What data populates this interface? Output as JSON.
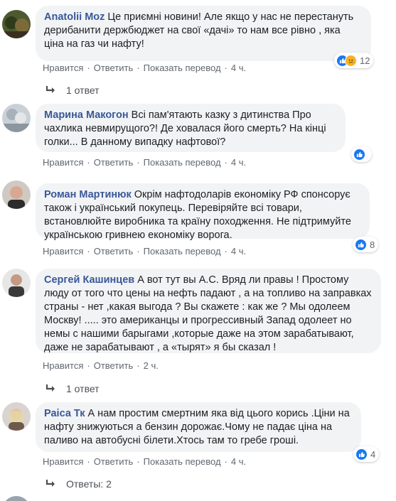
{
  "comments": [
    {
      "author": "Anatolii Moz",
      "text": "Це приємні новини! Але якщо у нас не перестануть дерибанити держбюджет на свої «дачі» то нам все рівно , яка ціна на газ чи нафту!",
      "reactions": {
        "icons": [
          "like-icon",
          "sad-icon"
        ],
        "count": "12"
      },
      "like": "Нравится",
      "reply": "Ответить",
      "translate": "Показать перевод",
      "time": "4 ч.",
      "replies": "1 ответ"
    },
    {
      "author": "Марина Макогон",
      "text": "Всі пам'ятають казку з дитинства Про чахлика невмирущого?! Де ховалася його смерть? На кінці голки... В данному випадку нафтової?",
      "reactions": {
        "icons": [
          "like-icon"
        ],
        "count": ""
      },
      "like": "Нравится",
      "reply": "Ответить",
      "translate": "Показать перевод",
      "time": "4 ч."
    },
    {
      "author": "Роман Мартинюк",
      "text": "Окрім нафтодоларів економіку РФ спонсорує також і український покупець. Перевіряйте всі товари, встановлюйте виробника та країну походження. Не підтримуйте українською гривнею економіку ворога.",
      "reactions": {
        "icons": [
          "like-icon"
        ],
        "count": "8"
      },
      "like": "Нравится",
      "reply": "Ответить",
      "translate": "Показать перевод",
      "time": "4 ч."
    },
    {
      "author": "Сергей Кашинцев",
      "text": "А вот тут вы А.С. Вряд ли правы ! Простому люду от того что цены на нефть падают , а на топливо на заправках страны - нет ,какая выгода ? Вы скажете : как же ? Мы одолеем Москву! ..... это американцы и прогрессивный Запад одолеет но немы с нашими барыгами ,которые даже на этом зарабатывают, даже не зарабатывают , а «тырят» я бы сказал !",
      "like": "Нравится",
      "reply": "Ответить",
      "time": "2 ч.",
      "replies": "1 ответ"
    },
    {
      "author": "Раіса Тк",
      "text": "А нам простим смертним яка від цього корись .Ціни на нафту знижуються а бензин дорожає.Чому не падає ціна на паливо на автобусні білети.Хтось там то гребе гроші.",
      "reactions": {
        "icons": [
          "like-icon"
        ],
        "count": "4"
      },
      "like": "Нравится",
      "reply": "Ответить",
      "translate": "Показать перевод",
      "time": "4 ч.",
      "replies": "Ответы: 2"
    }
  ],
  "colors": {
    "author": "#385898",
    "bubble": "#f2f3f5",
    "meta": "#606770",
    "like": "#1877f2",
    "sad": "#f7b125"
  }
}
